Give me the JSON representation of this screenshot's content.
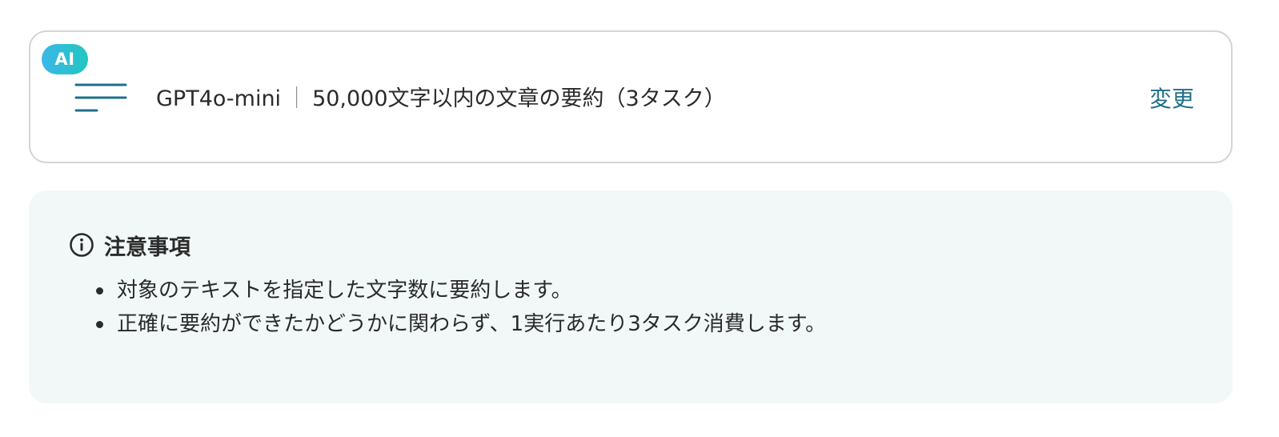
{
  "action": {
    "badge": "AI",
    "icon": "summary-lines-icon",
    "model": "GPT4o-mini",
    "separator": "｜",
    "description": "50,000文字以内の文章の要約（3タスク）",
    "change_label": "変更"
  },
  "notes": {
    "icon": "info-icon",
    "title": "注意事項",
    "items": [
      "対象のテキストを指定した文字数に要約します。",
      "正確に要約ができたかどうかに関わらず、1実行あたり3タスク消費します。"
    ]
  },
  "colors": {
    "accent_text": "#1f6f8b",
    "badge_gradient_start": "#3bb7e8",
    "badge_gradient_end": "#21c6c0",
    "notes_background": "#f2f8f8",
    "card_border": "#d4d4d4"
  }
}
